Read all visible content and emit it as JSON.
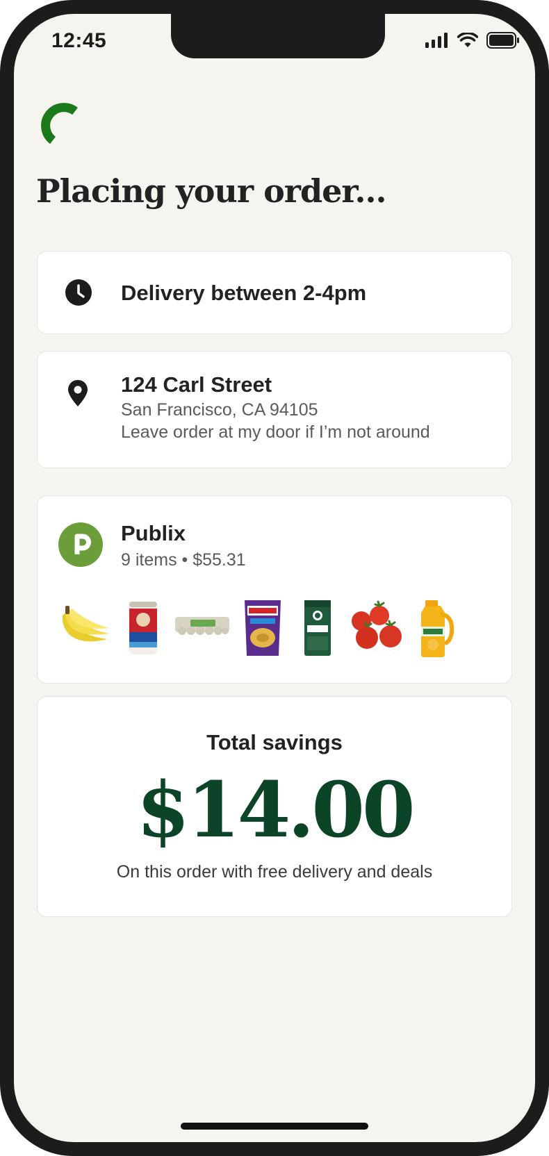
{
  "status_bar": {
    "time": "12:45",
    "icons": [
      "signal-icon",
      "wifi-icon",
      "battery-icon"
    ]
  },
  "page": {
    "title": "Placing your order..."
  },
  "delivery": {
    "icon": "clock-icon",
    "label": "Delivery between 2-4pm"
  },
  "address": {
    "icon": "location-pin-icon",
    "street": "124 Carl Street",
    "city": "San Francisco, CA 94105",
    "note": "Leave order at my door if I’m not around"
  },
  "store": {
    "name": "Publix",
    "summary": "9 items • $55.31",
    "logo_letter": "p",
    "logo_color": "#6b9e3b",
    "items": [
      "bananas",
      "quaker-oats",
      "eggs",
      "tostitos-chips",
      "pike-place-coffee",
      "tomatoes",
      "tropicana-juice"
    ]
  },
  "savings": {
    "label": "Total savings",
    "amount": "$14.00",
    "note": "On this order with free delivery and deals",
    "color": "#0b4426"
  },
  "colors": {
    "accent": "#1a7a1a",
    "background": "#f5f4ef"
  }
}
